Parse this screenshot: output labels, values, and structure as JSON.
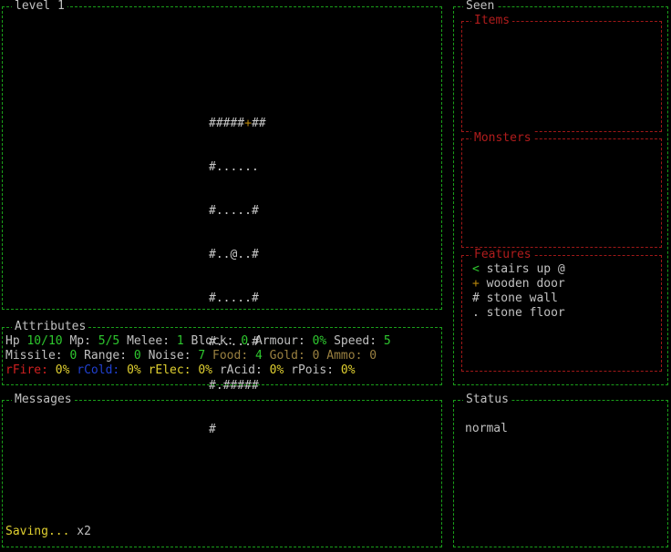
{
  "map_panel": {
    "title": "level 1",
    "rows": [
      "#####",
      "+",
      "##",
      "#......",
      "#.....#",
      "#..@..#",
      "#.....#",
      "#.....#",
      "#.#####",
      "#"
    ]
  },
  "seen_panel": {
    "title": "Seen",
    "items_title": "Items",
    "monsters_title": "Monsters",
    "features_title": "Features",
    "features": [
      {
        "glyph": "<",
        "label": "stairs up @",
        "color": "#2ec82e"
      },
      {
        "glyph": "+",
        "label": "wooden door",
        "color": "#b8860b"
      },
      {
        "glyph": "#",
        "label": "stone wall",
        "color": "#c8c8c8"
      },
      {
        "glyph": ".",
        "label": "stone floor",
        "color": "#c8c8c8"
      }
    ]
  },
  "attributes": {
    "title": "Attributes",
    "hp_label": "Hp",
    "hp_value": "10/10",
    "mp_label": "Mp:",
    "mp_value": "5/5",
    "melee_label": "Melee:",
    "melee_value": "1",
    "block_label": "Block:",
    "block_value": "0",
    "armour_label": "Armour:",
    "armour_value": "0%",
    "speed_label": "Speed:",
    "speed_value": "5",
    "missile_label": "Missile:",
    "missile_value": "0",
    "range_label": "Range:",
    "range_value": "0",
    "noise_label": "Noise:",
    "noise_value": "7",
    "food_label": "Food:",
    "food_value": "4",
    "gold_label": "Gold:",
    "gold_value": "0",
    "ammo_label": "Ammo:",
    "ammo_value": "0",
    "rfire_label": "rFire:",
    "rfire_value": "0%",
    "rcold_label": "rCold:",
    "rcold_value": "0%",
    "relec_label": "rElec:",
    "relec_value": "0%",
    "racid_label": "rAcid:",
    "racid_value": "0%",
    "rpois_label": "rPois:",
    "rpois_value": "0%"
  },
  "messages": {
    "title": "Messages",
    "last_message": "Saving...",
    "repeat": "x2"
  },
  "status": {
    "title": "Status",
    "value": "normal"
  },
  "colors": {
    "border": "#1a9e1a",
    "seen_border": "#a01818",
    "highlight": "#2ec82e",
    "warning": "#e0d030"
  }
}
